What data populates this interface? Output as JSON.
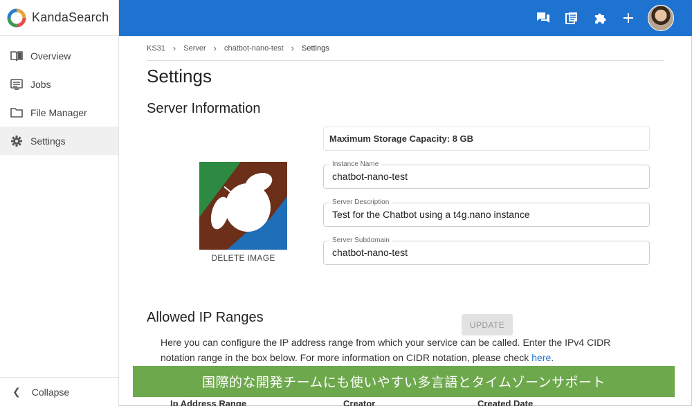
{
  "brand": {
    "name": "KandaSearch"
  },
  "sidebar": {
    "items": [
      {
        "label": "Overview",
        "icon": "book-open-icon"
      },
      {
        "label": "Jobs",
        "icon": "list-icon"
      },
      {
        "label": "File Manager",
        "icon": "folder-icon"
      },
      {
        "label": "Settings",
        "icon": "gear-icon",
        "active": true
      }
    ],
    "collapse_label": "Collapse"
  },
  "topbar": {
    "icons": [
      "chat-icon",
      "docs-icon",
      "puzzle-icon",
      "plus-icon",
      "avatar"
    ],
    "color": "#1e72d0"
  },
  "breadcrumb": {
    "items": [
      "KS31",
      "Server",
      "chatbot-nano-test",
      "Settings"
    ]
  },
  "page": {
    "title": "Settings"
  },
  "server_info": {
    "title": "Server Information",
    "max_storage": "Maximum Storage Capacity: 8 GB",
    "delete_image_label": "DELETE IMAGE",
    "fields": {
      "instance_name": {
        "label": "Instance Name",
        "value": "chatbot-nano-test"
      },
      "description": {
        "label": "Server Description",
        "value": "Test for the Chatbot using a t4g.nano instance"
      },
      "subdomain": {
        "label": "Server Subdomain",
        "value": "chatbot-nano-test"
      }
    },
    "update_label": "UPDATE"
  },
  "ip_ranges": {
    "title": "Allowed IP Ranges",
    "description": "Here you can configure the IP address range from which your service can be called. Enter the IPv4 CIDR notation range in the box below. For more information on CIDR notation, please check",
    "link_text": "here",
    "link_suffix": ".",
    "columns": [
      "Ip Address Range",
      "Creator",
      "Created Date"
    ]
  },
  "caption": {
    "text": "国際的な開発チームにも使いやすい多言語とタイムゾーンサポート",
    "color": "#6ea84d"
  }
}
